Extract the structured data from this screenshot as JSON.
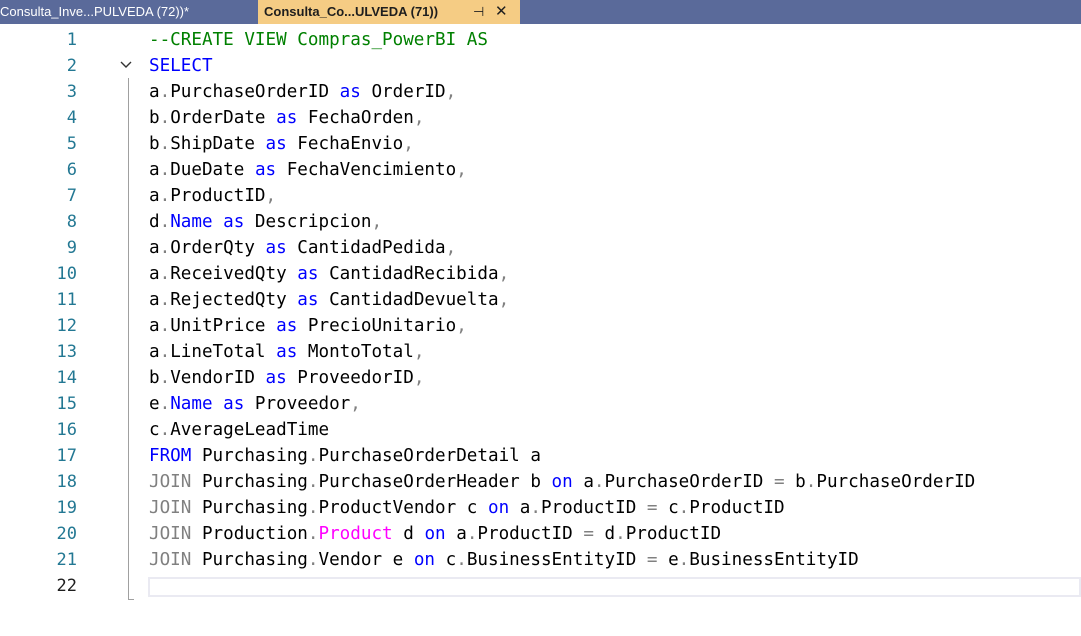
{
  "tabs": [
    {
      "label": "Consulta_Inve...PULVEDA (72))*",
      "active": false
    },
    {
      "label": "Consulta_Co...ULVEDA (71))",
      "active": true,
      "pin": "⊣",
      "close": "✕"
    }
  ],
  "editor": {
    "current_line": 22,
    "lines": [
      {
        "n": "1",
        "tokens": [
          {
            "t": "--CREATE VIEW Compras_PowerBI AS",
            "c": "cmt"
          }
        ]
      },
      {
        "n": "2",
        "tokens": [
          {
            "t": "SELECT",
            "c": "kw"
          }
        ]
      },
      {
        "n": "3",
        "tokens": [
          {
            "t": "a",
            "c": ""
          },
          {
            "t": ".",
            "c": "gray"
          },
          {
            "t": "PurchaseOrderID ",
            "c": ""
          },
          {
            "t": "as",
            "c": "kw"
          },
          {
            "t": " OrderID",
            "c": ""
          },
          {
            "t": ",",
            "c": "gray"
          }
        ]
      },
      {
        "n": "4",
        "tokens": [
          {
            "t": "b",
            "c": ""
          },
          {
            "t": ".",
            "c": "gray"
          },
          {
            "t": "OrderDate ",
            "c": ""
          },
          {
            "t": "as",
            "c": "kw"
          },
          {
            "t": " FechaOrden",
            "c": ""
          },
          {
            "t": ",",
            "c": "gray"
          }
        ]
      },
      {
        "n": "5",
        "tokens": [
          {
            "t": "b",
            "c": ""
          },
          {
            "t": ".",
            "c": "gray"
          },
          {
            "t": "ShipDate ",
            "c": ""
          },
          {
            "t": "as",
            "c": "kw"
          },
          {
            "t": " FechaEnvio",
            "c": ""
          },
          {
            "t": ",",
            "c": "gray"
          }
        ]
      },
      {
        "n": "6",
        "tokens": [
          {
            "t": "a",
            "c": ""
          },
          {
            "t": ".",
            "c": "gray"
          },
          {
            "t": "DueDate ",
            "c": ""
          },
          {
            "t": "as",
            "c": "kw"
          },
          {
            "t": " FechaVencimiento",
            "c": ""
          },
          {
            "t": ",",
            "c": "gray"
          }
        ]
      },
      {
        "n": "7",
        "tokens": [
          {
            "t": "a",
            "c": ""
          },
          {
            "t": ".",
            "c": "gray"
          },
          {
            "t": "ProductID",
            "c": ""
          },
          {
            "t": ",",
            "c": "gray"
          }
        ]
      },
      {
        "n": "8",
        "tokens": [
          {
            "t": "d",
            "c": ""
          },
          {
            "t": ".",
            "c": "gray"
          },
          {
            "t": "Name",
            "c": "kw"
          },
          {
            "t": " ",
            "c": ""
          },
          {
            "t": "as",
            "c": "kw"
          },
          {
            "t": " Descripcion",
            "c": ""
          },
          {
            "t": ",",
            "c": "gray"
          }
        ]
      },
      {
        "n": "9",
        "tokens": [
          {
            "t": "a",
            "c": ""
          },
          {
            "t": ".",
            "c": "gray"
          },
          {
            "t": "OrderQty ",
            "c": ""
          },
          {
            "t": "as",
            "c": "kw"
          },
          {
            "t": " CantidadPedida",
            "c": ""
          },
          {
            "t": ",",
            "c": "gray"
          }
        ]
      },
      {
        "n": "10",
        "tokens": [
          {
            "t": "a",
            "c": ""
          },
          {
            "t": ".",
            "c": "gray"
          },
          {
            "t": "ReceivedQty ",
            "c": ""
          },
          {
            "t": "as",
            "c": "kw"
          },
          {
            "t": " CantidadRecibida",
            "c": ""
          },
          {
            "t": ",",
            "c": "gray"
          }
        ]
      },
      {
        "n": "11",
        "tokens": [
          {
            "t": "a",
            "c": ""
          },
          {
            "t": ".",
            "c": "gray"
          },
          {
            "t": "RejectedQty ",
            "c": ""
          },
          {
            "t": "as",
            "c": "kw"
          },
          {
            "t": " CantidadDevuelta",
            "c": ""
          },
          {
            "t": ",",
            "c": "gray"
          }
        ]
      },
      {
        "n": "12",
        "tokens": [
          {
            "t": "a",
            "c": ""
          },
          {
            "t": ".",
            "c": "gray"
          },
          {
            "t": "UnitPrice ",
            "c": ""
          },
          {
            "t": "as",
            "c": "kw"
          },
          {
            "t": " PrecioUnitario",
            "c": ""
          },
          {
            "t": ",",
            "c": "gray"
          }
        ]
      },
      {
        "n": "13",
        "tokens": [
          {
            "t": "a",
            "c": ""
          },
          {
            "t": ".",
            "c": "gray"
          },
          {
            "t": "LineTotal ",
            "c": ""
          },
          {
            "t": "as",
            "c": "kw"
          },
          {
            "t": " MontoTotal",
            "c": ""
          },
          {
            "t": ",",
            "c": "gray"
          }
        ]
      },
      {
        "n": "14",
        "tokens": [
          {
            "t": "b",
            "c": ""
          },
          {
            "t": ".",
            "c": "gray"
          },
          {
            "t": "VendorID ",
            "c": ""
          },
          {
            "t": "as",
            "c": "kw"
          },
          {
            "t": " ProveedorID",
            "c": ""
          },
          {
            "t": ",",
            "c": "gray"
          }
        ]
      },
      {
        "n": "15",
        "tokens": [
          {
            "t": "e",
            "c": ""
          },
          {
            "t": ".",
            "c": "gray"
          },
          {
            "t": "Name",
            "c": "kw"
          },
          {
            "t": " ",
            "c": ""
          },
          {
            "t": "as",
            "c": "kw"
          },
          {
            "t": " Proveedor",
            "c": ""
          },
          {
            "t": ",",
            "c": "gray"
          }
        ]
      },
      {
        "n": "16",
        "tokens": [
          {
            "t": "c",
            "c": ""
          },
          {
            "t": ".",
            "c": "gray"
          },
          {
            "t": "AverageLeadTime",
            "c": ""
          }
        ]
      },
      {
        "n": "17",
        "tokens": [
          {
            "t": "FROM",
            "c": "kw"
          },
          {
            "t": " Purchasing",
            "c": ""
          },
          {
            "t": ".",
            "c": "gray"
          },
          {
            "t": "PurchaseOrderDetail a",
            "c": ""
          }
        ]
      },
      {
        "n": "18",
        "tokens": [
          {
            "t": "JOIN",
            "c": "gray"
          },
          {
            "t": " Purchasing",
            "c": ""
          },
          {
            "t": ".",
            "c": "gray"
          },
          {
            "t": "PurchaseOrderHeader b ",
            "c": ""
          },
          {
            "t": "on",
            "c": "kw"
          },
          {
            "t": " a",
            "c": ""
          },
          {
            "t": ".",
            "c": "gray"
          },
          {
            "t": "PurchaseOrderID ",
            "c": ""
          },
          {
            "t": "=",
            "c": "gray"
          },
          {
            "t": " b",
            "c": ""
          },
          {
            "t": ".",
            "c": "gray"
          },
          {
            "t": "PurchaseOrderID",
            "c": ""
          }
        ]
      },
      {
        "n": "19",
        "tokens": [
          {
            "t": "JOIN",
            "c": "gray"
          },
          {
            "t": " Purchasing",
            "c": ""
          },
          {
            "t": ".",
            "c": "gray"
          },
          {
            "t": "ProductVendor c ",
            "c": ""
          },
          {
            "t": "on",
            "c": "kw"
          },
          {
            "t": " a",
            "c": ""
          },
          {
            "t": ".",
            "c": "gray"
          },
          {
            "t": "ProductID ",
            "c": ""
          },
          {
            "t": "=",
            "c": "gray"
          },
          {
            "t": " c",
            "c": ""
          },
          {
            "t": ".",
            "c": "gray"
          },
          {
            "t": "ProductID",
            "c": ""
          }
        ]
      },
      {
        "n": "20",
        "tokens": [
          {
            "t": "JOIN",
            "c": "gray"
          },
          {
            "t": " Production",
            "c": ""
          },
          {
            "t": ".",
            "c": "gray"
          },
          {
            "t": "Product",
            "c": "fn"
          },
          {
            "t": " d ",
            "c": ""
          },
          {
            "t": "on",
            "c": "kw"
          },
          {
            "t": " a",
            "c": ""
          },
          {
            "t": ".",
            "c": "gray"
          },
          {
            "t": "ProductID ",
            "c": ""
          },
          {
            "t": "=",
            "c": "gray"
          },
          {
            "t": " d",
            "c": ""
          },
          {
            "t": ".",
            "c": "gray"
          },
          {
            "t": "ProductID",
            "c": ""
          }
        ]
      },
      {
        "n": "21",
        "tokens": [
          {
            "t": "JOIN",
            "c": "gray"
          },
          {
            "t": " Purchasing",
            "c": ""
          },
          {
            "t": ".",
            "c": "gray"
          },
          {
            "t": "Vendor e ",
            "c": ""
          },
          {
            "t": "on",
            "c": "kw"
          },
          {
            "t": " c",
            "c": ""
          },
          {
            "t": ".",
            "c": "gray"
          },
          {
            "t": "BusinessEntityID ",
            "c": ""
          },
          {
            "t": "=",
            "c": "gray"
          },
          {
            "t": " e",
            "c": ""
          },
          {
            "t": ".",
            "c": "gray"
          },
          {
            "t": "BusinessEntityID",
            "c": ""
          }
        ]
      },
      {
        "n": "22",
        "tokens": []
      }
    ]
  },
  "colors": {
    "tabbar": "#5a6a9a",
    "active_tab": "#f5cc84",
    "keyword": "#0000ff",
    "comment": "#008000",
    "function": "#ff00ff",
    "punctuation": "#808080",
    "line_number": "#237893"
  }
}
